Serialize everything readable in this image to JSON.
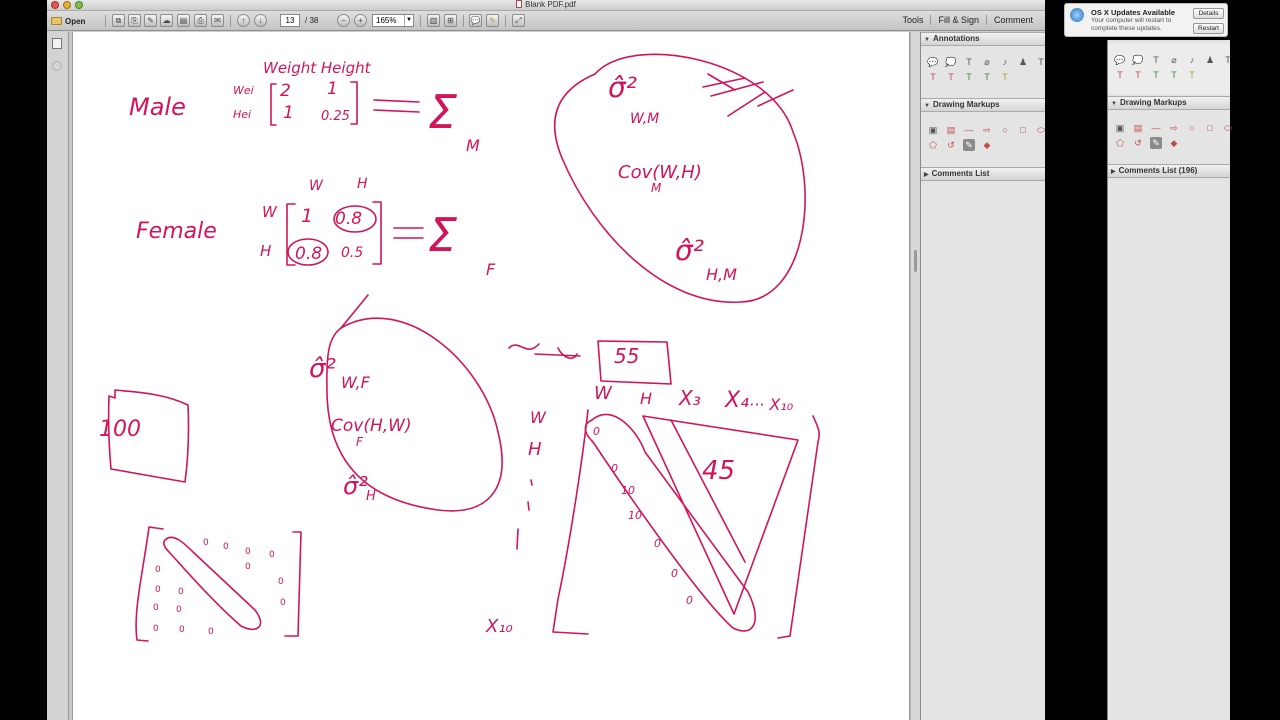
{
  "window": {
    "title": "Blank PDF.pdf"
  },
  "toolbar": {
    "open_label": "Open",
    "page_current": "13",
    "page_total": "/ 38",
    "zoom": "165%",
    "tools_label": "Tools",
    "fill_sign_label": "Fill & Sign",
    "comment_label": "Comment"
  },
  "panel": {
    "annotations_title": "Annotations",
    "drawing_markups_title": "Drawing Markups",
    "comments_list_title": "Comments List",
    "comments_list_title_2": "Comments List (196)"
  },
  "notification": {
    "title": "OS X Updates Available",
    "text": "Your computer will restart to complete these updates.",
    "details_label": "Details",
    "restart_label": "Restart"
  },
  "colors": {
    "ink": "#d2145a",
    "toolbar": "#d0d0d0",
    "panel": "#e4e4e4"
  },
  "handwriting": {
    "weight_height": "Weight Height",
    "male": "Male",
    "wei": "Wei",
    "hei": "Hei",
    "m11": "2",
    "m12": "1",
    "m21": "1",
    "m22": "0.25",
    "sigma": "Σ",
    "sub_m": "M",
    "sub_f": "F",
    "w": "W",
    "h": "H",
    "female": "Female",
    "f11": "1",
    "f12": "0.8",
    "f21": "0.8",
    "f22": "0.5",
    "sig_wm": "σ̂²",
    "sub_wm": "W,M",
    "cov_m": "Cov(W,H)",
    "sub_cov_m": "M",
    "sig_hm": "σ̂²",
    "sub_hm": "H,M",
    "sig_wf": "σ̂²",
    "sub_wf": "W,F",
    "cov_f": "Cov(H,W)",
    "sub_cov_f": "F",
    "sig_h": "σ̂²",
    "sub_h": "H",
    "num100": "100",
    "num55": "55",
    "num45": "45",
    "x3": "X₃",
    "x4": "X₄",
    "xdots": "··· X₁₀",
    "x10": "X₁₀",
    "zero": "0",
    "ten": "10"
  }
}
